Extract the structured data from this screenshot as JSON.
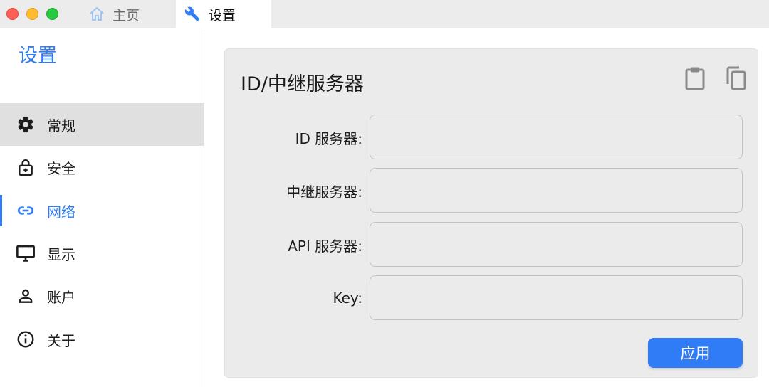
{
  "window": {
    "tabs": [
      {
        "label": "主页",
        "icon": "home-icon"
      },
      {
        "label": "设置",
        "icon": "wrench-icon"
      }
    ]
  },
  "sidebar": {
    "title": "设置",
    "items": [
      {
        "label": "常规",
        "icon": "gear-icon"
      },
      {
        "label": "安全",
        "icon": "lock-icon"
      },
      {
        "label": "网络",
        "icon": "link-icon"
      },
      {
        "label": "显示",
        "icon": "monitor-icon"
      },
      {
        "label": "账户",
        "icon": "person-icon"
      },
      {
        "label": "关于",
        "icon": "info-icon"
      }
    ],
    "active_item": "网络"
  },
  "main": {
    "card_title": "ID/中继服务器",
    "fields": [
      {
        "label": "ID 服务器:",
        "value": "",
        "placeholder": ""
      },
      {
        "label": "中继服务器:",
        "value": "",
        "placeholder": ""
      },
      {
        "label": "API 服务器:",
        "value": "",
        "placeholder": ""
      },
      {
        "label": "Key:",
        "value": "",
        "placeholder": ""
      }
    ],
    "apply_label": "应用"
  },
  "colors": {
    "accent": "#2f7cf6",
    "card_bg": "#ebebeb",
    "titlebar_bg": "#ececec"
  }
}
